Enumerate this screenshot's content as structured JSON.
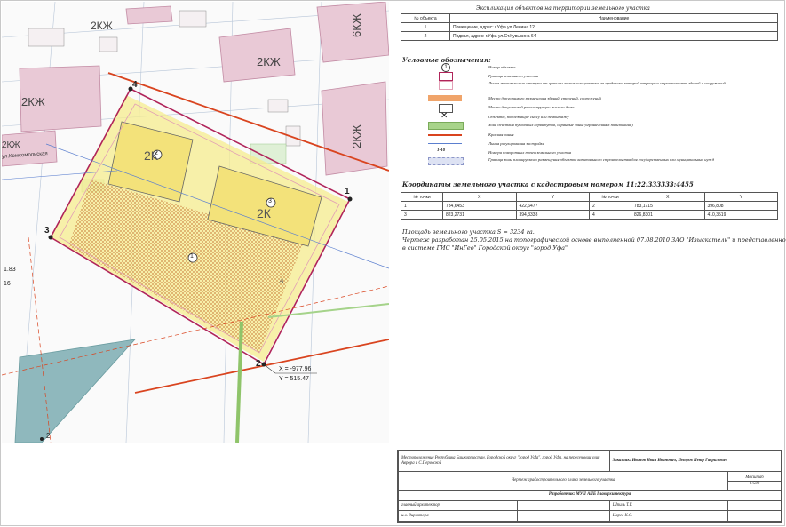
{
  "map": {
    "building_labels": [
      "2КЖ",
      "2КЖ",
      "2КЖ",
      "6КЖ",
      "2КЖ",
      "2КЖ",
      "2К",
      "2К"
    ],
    "point_labels": [
      "1",
      "2",
      "3",
      "4"
    ],
    "object_numbers": [
      "1",
      "2",
      "3"
    ],
    "zone_label": "А",
    "street_label": "ул.Комсомольская",
    "coord_x": "Х = -977.96",
    "coord_y": "Y = 515.47",
    "side_label_1": "1.83",
    "side_label_2": "16",
    "wedge_label": "2"
  },
  "explication": {
    "title": "Экспликация объектов на территории земельного участка",
    "headers": [
      "№ объекта",
      "Наименование"
    ],
    "rows": [
      [
        "1",
        "Помещение, адрес: г.Уфа ул.Ленина 12"
      ],
      [
        "2",
        "Подвал, адрес: г.Уфа ул.Ст.Кувыкина 64"
      ]
    ]
  },
  "legend": {
    "title": "Условные обозначения:",
    "symbol_number": "1",
    "range_label": "1-10",
    "items": [
      "Номер объекта",
      "Граница земельного участка",
      "Линия минимального отступа от границы земельного участка, за пределами которой запрещено строительство зданий и сооружений",
      "Место допустимого размещения зданий, строений, сооружений",
      "Место допустимой реконструкции жилого дома",
      "Объекты, подлежащие сносу или демонтажу",
      "Зона действия публичных сервитутов, охранные зоны (ограничения в пользовании)",
      "Красная линия",
      "Линия регулирования застройки",
      "Номера поворотных точек земельного участка",
      "Граница зоны планируемого размещения объектов капитального строительства для государственных или муниципальных нужд"
    ]
  },
  "coordinates": {
    "title": "Координаты земельного участка с кадастровым номером 11:22:333333:4455",
    "headers": [
      "№ точки",
      "X",
      "Y",
      "№ точки",
      "X",
      "Y"
    ],
    "rows": [
      [
        "1",
        "784,6453",
        "422,6477",
        "2",
        "783,1715",
        "396,808"
      ],
      [
        "3",
        "823,2731",
        "394,3338",
        "4",
        "826,8301",
        "410,3519"
      ]
    ]
  },
  "notes": {
    "area": "Площадь земельного участка S = 3234 га.",
    "drawing_1": "Чертеж разработан 25.05.2015 на топографической основе выполненной 07.08.2010 ЗАО \"Изыскатель\" и представленной",
    "drawing_2": "в системе ГИС \"ИнГео\" Городской округ \"город Уфа\""
  },
  "stamp": {
    "location": "Местоположение Республика Башкортостан, Городской округ \"город Уфа\", город Уфа, на пересечении улиц Аврора и С.Перовской",
    "customer": "Заказчик: Иванов Иван Иванович, Петров Петр Гаврилович",
    "drawing_title": "Чертеж градостроительного плана земельного участка",
    "scale_label": "Масштаб",
    "scale_value": "1:500",
    "developer": "Разработчик: МУП АПБ Главархитектура",
    "role_1": "главный архитектор",
    "name_1": "Шпиль Т.Г.",
    "role_2": "и.о. директора",
    "name_2": "Царев К.С."
  }
}
